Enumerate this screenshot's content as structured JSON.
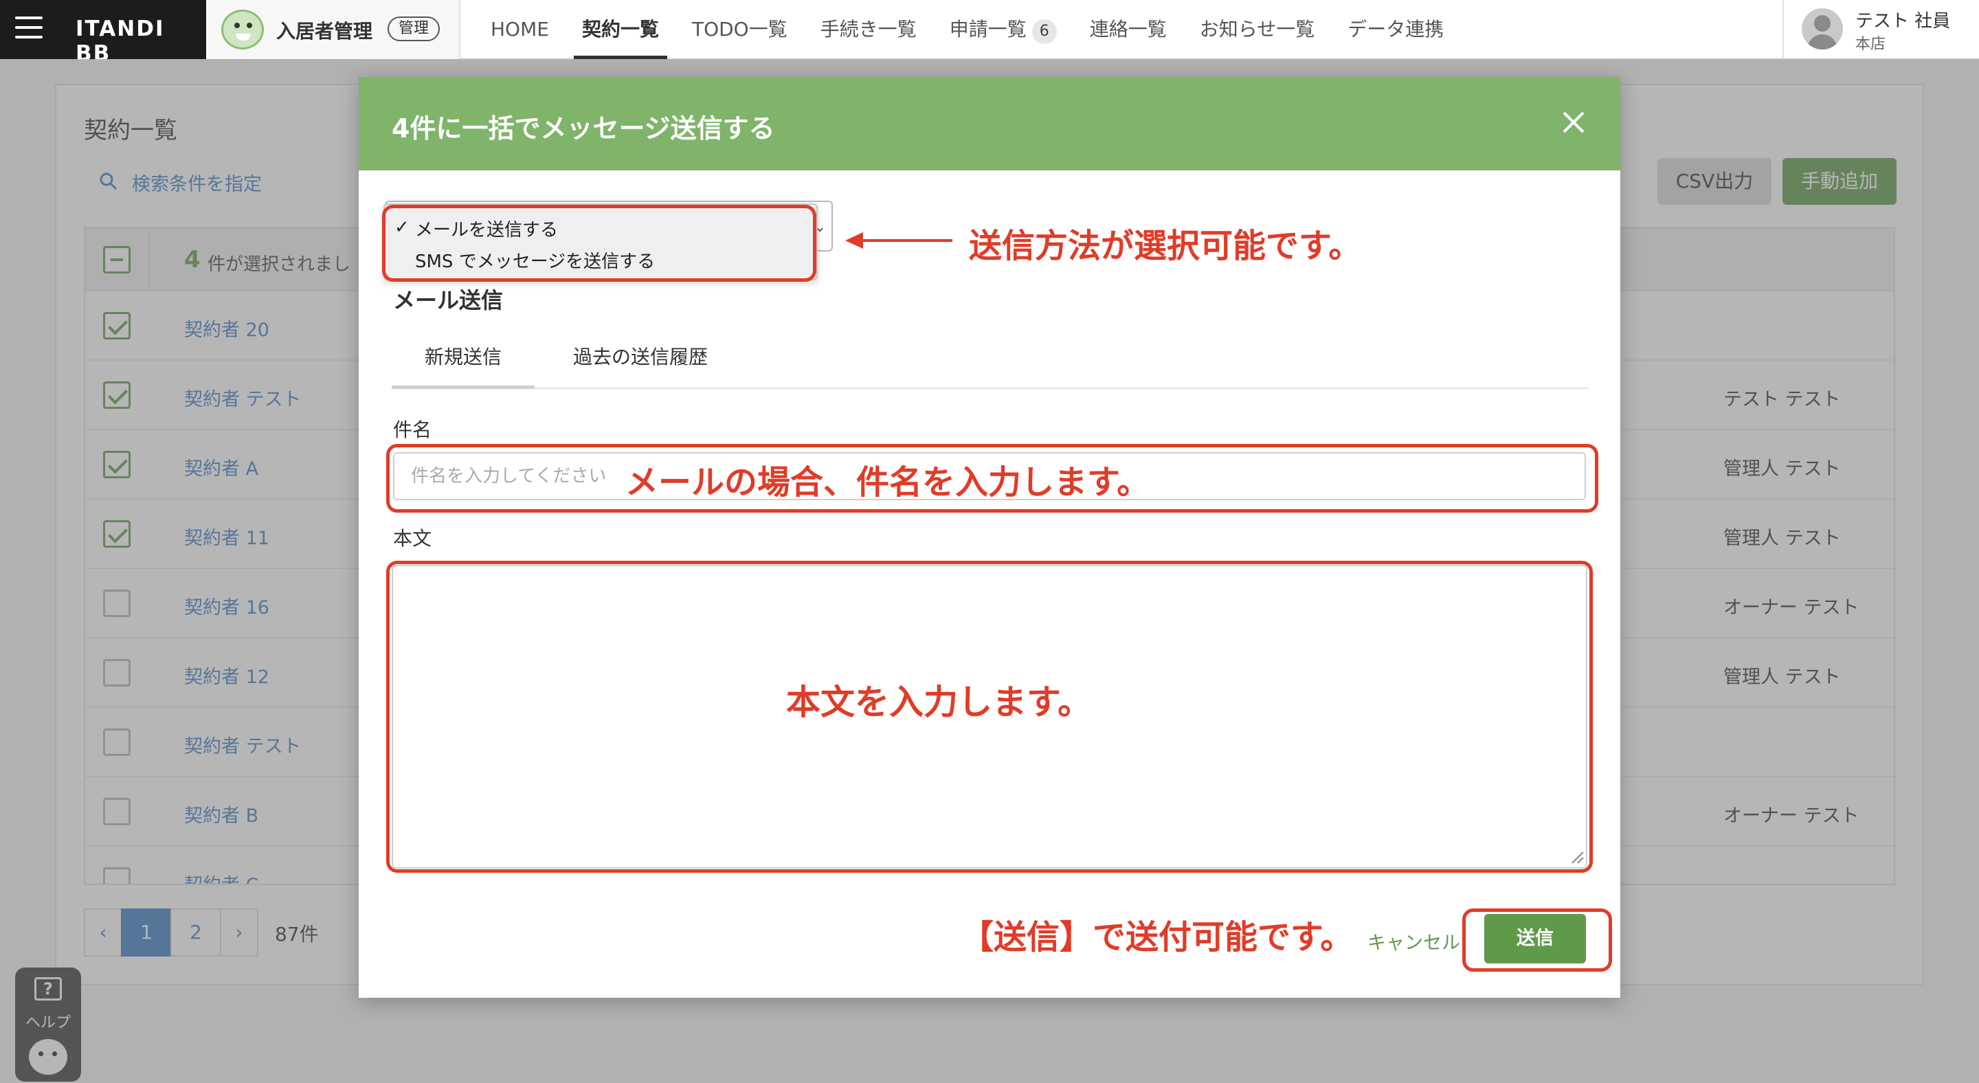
{
  "header": {
    "logo": "ITANDI BB",
    "app_title": "入居者管理",
    "app_badge": "管理",
    "nav": [
      {
        "label": "HOME"
      },
      {
        "label": "契約一覧"
      },
      {
        "label": "TODO一覧"
      },
      {
        "label": "手続き一覧"
      },
      {
        "label": "申請一覧",
        "count": "6"
      },
      {
        "label": "連絡一覧"
      },
      {
        "label": "お知らせ一覧"
      },
      {
        "label": "データ連携"
      }
    ],
    "user_name": "テスト 社員",
    "user_branch": "本店"
  },
  "page": {
    "title": "契約一覧",
    "search_link": "検索条件を指定",
    "csv_button": "CSV出力",
    "add_button": "手動追加",
    "selected_count": "4",
    "selected_text": "件が選択されまし",
    "rows": [
      {
        "name": "契約者 20",
        "owner": "",
        "checked": true
      },
      {
        "name": "契約者 テスト",
        "owner": "テスト テスト",
        "checked": true
      },
      {
        "name": "契約者 A",
        "owner": "管理人 テスト",
        "checked": true
      },
      {
        "name": "契約者 11",
        "owner": "管理人 テスト",
        "checked": true
      },
      {
        "name": "契約者 16",
        "owner": "オーナー テスト",
        "checked": false
      },
      {
        "name": "契約者 12",
        "owner": "管理人 テスト",
        "checked": false
      },
      {
        "name": "契約者 テスト",
        "owner": "",
        "checked": false
      },
      {
        "name": "契約者 B",
        "owner": "オーナー テスト",
        "checked": false
      },
      {
        "name": "契約者 C",
        "owner": "",
        "checked": false
      }
    ],
    "pager": {
      "prev": "‹",
      "pages": [
        "1",
        "2"
      ],
      "current": "1",
      "next": "›",
      "total": "87件"
    },
    "help_label": "ヘルプ"
  },
  "modal": {
    "title": "4件に一括でメッセージ送信する",
    "send_method": {
      "selected": "メールを送信する",
      "options": [
        "メールを送信する",
        "SMS でメッセージを送信する"
      ],
      "check_mark": "✓"
    },
    "section_title": "メール送信",
    "tabs": [
      {
        "label": "新規送信",
        "active": true
      },
      {
        "label": "過去の送信履歴",
        "active": false
      }
    ],
    "subject_label": "件名",
    "subject_placeholder": "件名を入力してください",
    "subject_value": "",
    "body_label": "本文",
    "body_value": "",
    "cancel_label": "キャンセル",
    "send_label": "送信"
  },
  "annotations": {
    "send_method_note": "送信方法が選択可能です。",
    "subject_note": "メールの場合、件名を入力します。",
    "body_note": "本文を入力します。",
    "send_note": "【送信】で送付可能です。"
  },
  "colors": {
    "accent_green": "#5f9a4b",
    "header_green": "#7fb46a",
    "link_blue": "#3d7fc4",
    "annotation_red": "#e03c28"
  }
}
